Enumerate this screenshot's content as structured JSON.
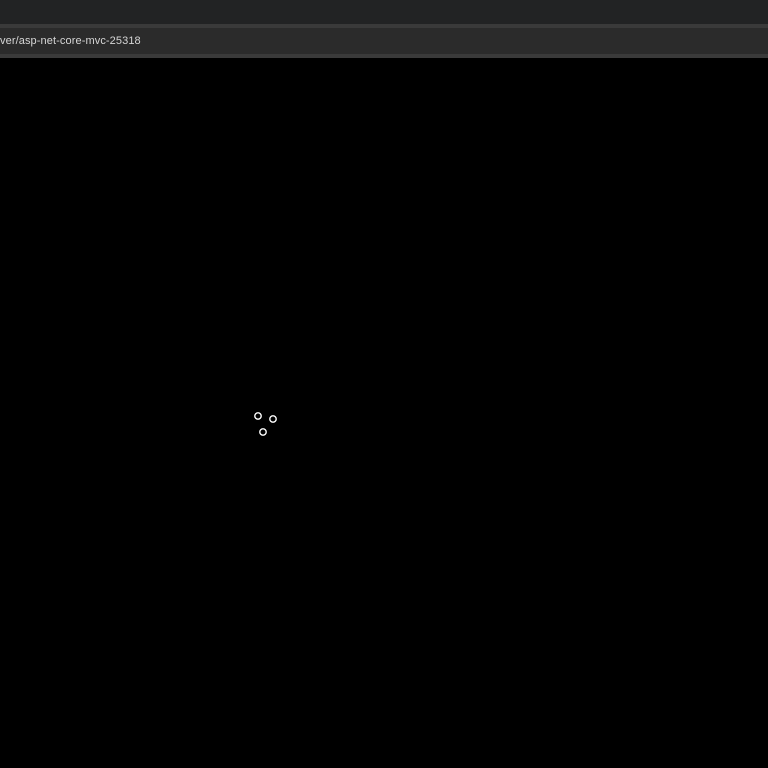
{
  "browser": {
    "address": {
      "url": "ver/asp-net-core-mvc-25318"
    }
  },
  "page": {
    "state": "loading",
    "spinner_icon": "loading-spinner-icon"
  },
  "colors": {
    "chrome_top": "#222324",
    "chrome_divider": "#3a3a3a",
    "address_bar": "#2b2b2b",
    "address_text": "#d6d6d6",
    "page_background": "#000000",
    "spinner_ring": "#ffffff"
  }
}
